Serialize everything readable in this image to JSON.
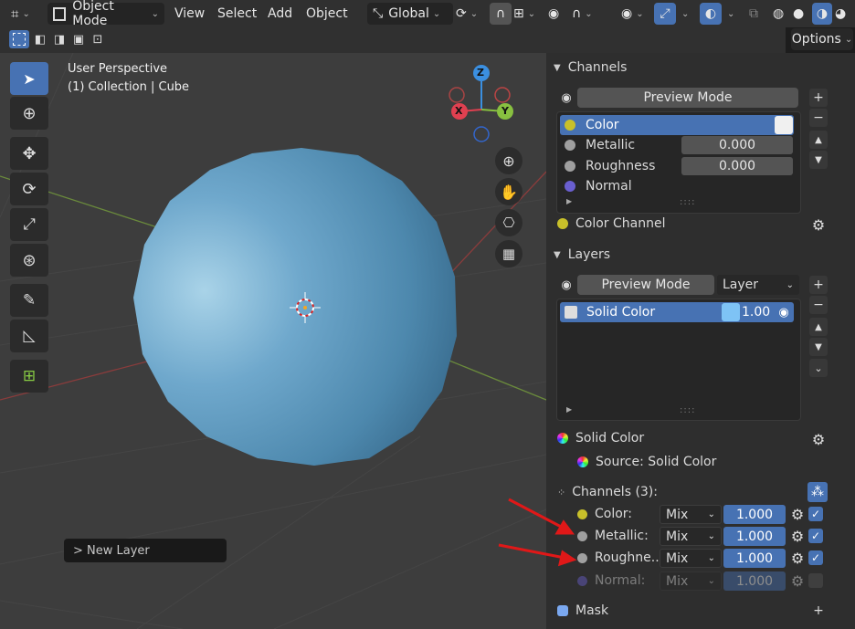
{
  "header": {
    "mode": "Object Mode",
    "menus": [
      "View",
      "Select",
      "Add",
      "Object"
    ],
    "transform_orientation": "Global",
    "options_label": "Options"
  },
  "viewport": {
    "overlay_line1": "User Perspective",
    "overlay_line2": "(1) Collection | Cube",
    "gizmo_x": "X",
    "gizmo_y": "Y",
    "gizmo_z": "Z",
    "redo_panel": "> New Layer",
    "sphere_color": "#5d98bd"
  },
  "channels_panel": {
    "title": "Channels",
    "preview_mode": "Preview Mode",
    "items": [
      {
        "label": "Color",
        "color": "#c8c02a",
        "value": "",
        "selected": true
      },
      {
        "label": "Metallic",
        "color": "#a0a0a0",
        "value": "0.000"
      },
      {
        "label": "Roughness",
        "color": "#a0a0a0",
        "value": "0.000"
      },
      {
        "label": "Normal",
        "color": "#6a5fd0",
        "value": ""
      }
    ],
    "footer": "Color Channel"
  },
  "layers_panel": {
    "title": "Layers",
    "preview_mode": "Preview Mode",
    "layer_dropdown": "Layer",
    "layer": {
      "name": "Solid Color",
      "opacity": "1.00",
      "swatch": "#7ec3f5"
    },
    "layer_props_title": "Solid Color",
    "source_label": "Source: Solid Color",
    "channels_title": "Channels (3):",
    "channel_rows": [
      {
        "label": "Color:",
        "blend": "Mix",
        "value": "1.000",
        "enabled": true
      },
      {
        "label": "Metallic:",
        "blend": "Mix",
        "value": "1.000",
        "enabled": true
      },
      {
        "label": "Roughne...",
        "blend": "Mix",
        "value": "1.000",
        "enabled": true
      },
      {
        "label": "Normal:",
        "blend": "Mix",
        "value": "1.000",
        "enabled": false
      }
    ],
    "mask_label": "Mask"
  },
  "colors": {
    "accent": "#4772b3",
    "arrow": "#e01818"
  }
}
